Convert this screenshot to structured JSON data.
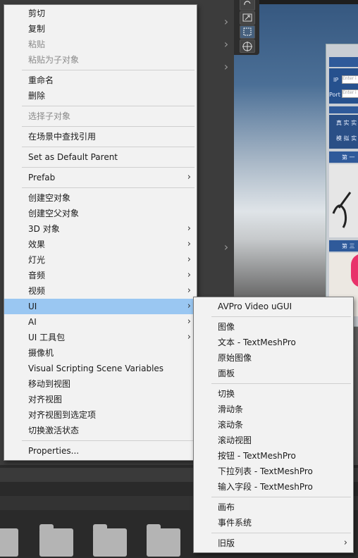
{
  "menu": {
    "items": [
      {
        "label": "剪切",
        "enabled": true
      },
      {
        "label": "复制",
        "enabled": true
      },
      {
        "label": "粘贴",
        "enabled": false
      },
      {
        "label": "粘贴为子对象",
        "enabled": false
      },
      {
        "label": "重命名",
        "enabled": true
      },
      {
        "label": "删除",
        "enabled": true
      },
      {
        "label": "选择子对象",
        "enabled": false
      },
      {
        "label": "在场景中查找引用",
        "enabled": true
      },
      {
        "label": "Set as Default Parent",
        "enabled": true
      },
      {
        "label": "Prefab",
        "enabled": true,
        "submenu": true
      },
      {
        "label": "创建空对象",
        "enabled": true
      },
      {
        "label": "创建空父对象",
        "enabled": true
      },
      {
        "label": "3D 对象",
        "enabled": true,
        "submenu": true
      },
      {
        "label": "效果",
        "enabled": true,
        "submenu": true
      },
      {
        "label": "灯光",
        "enabled": true,
        "submenu": true
      },
      {
        "label": "音频",
        "enabled": true,
        "submenu": true
      },
      {
        "label": "视频",
        "enabled": true,
        "submenu": true
      },
      {
        "label": "UI",
        "enabled": true,
        "submenu": true,
        "highlighted": true
      },
      {
        "label": "AI",
        "enabled": true,
        "submenu": true
      },
      {
        "label": "UI 工具包",
        "enabled": true,
        "submenu": true
      },
      {
        "label": "摄像机",
        "enabled": true
      },
      {
        "label": "Visual Scripting Scene Variables",
        "enabled": true
      },
      {
        "label": "移动到视图",
        "enabled": true
      },
      {
        "label": "对齐视图",
        "enabled": true
      },
      {
        "label": "对齐视图到选定项",
        "enabled": true
      },
      {
        "label": "切换激活状态",
        "enabled": true
      },
      {
        "label": "Properties...",
        "enabled": true
      }
    ]
  },
  "submenu": {
    "items": [
      {
        "label": "AVPro Video uGUI"
      },
      {
        "label": "图像"
      },
      {
        "label": "文本 - TextMeshPro"
      },
      {
        "label": "原始图像"
      },
      {
        "label": "面板"
      },
      {
        "label": "切换"
      },
      {
        "label": "滑动条"
      },
      {
        "label": "滚动条"
      },
      {
        "label": "滚动视图"
      },
      {
        "label": "按钮 - TextMeshPro"
      },
      {
        "label": "下拉列表 - TextMeshPro"
      },
      {
        "label": "输入字段 - TextMeshPro"
      },
      {
        "label": "画布"
      },
      {
        "label": "事件系统"
      },
      {
        "label": "旧版",
        "submenu": true
      }
    ]
  },
  "scene": {
    "ip_label": "IP",
    "port_label": "Port",
    "input_placeholder": "Enter i",
    "btn_real": "真 实 实",
    "btn_sim": "模 拟 实",
    "header_1": "第 一",
    "header_3": "第 三"
  },
  "icons": {
    "submenu_arrow": "chevron-right-icon",
    "folder": "folder-icon"
  },
  "colors": {
    "menu_bg": "#f2f2f2",
    "highlight": "#9ac7f2",
    "disabled_text": "#8a8a8a",
    "editor_bg": "#3c3c3c"
  }
}
